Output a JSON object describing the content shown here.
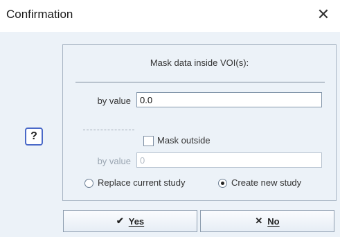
{
  "window": {
    "title": "Confirmation",
    "close_glyph": "✕"
  },
  "help": {
    "label": "?",
    "icon": "question-icon"
  },
  "panel": {
    "heading": "Mask data inside VOI(s):",
    "by_value_label": "by value",
    "by_value": "0.0",
    "dashes": "--------------",
    "mask_outside_label": "Mask outside",
    "mask_outside_checked": false,
    "outside_by_value_label": "by value",
    "outside_by_value": "0",
    "outside_enabled": false,
    "radio_options": [
      {
        "label": "Replace current study",
        "checked": false
      },
      {
        "label": "Create new study",
        "checked": true
      }
    ]
  },
  "buttons": {
    "yes": {
      "label": "Yes",
      "icon": "check-icon",
      "glyph": "✔"
    },
    "no": {
      "label": "No",
      "icon": "x-icon",
      "glyph": "✕"
    }
  },
  "colors": {
    "client_bg": "#ecf2f8",
    "help_border": "#4a69c8",
    "panel_border": "#a7b4c3"
  }
}
